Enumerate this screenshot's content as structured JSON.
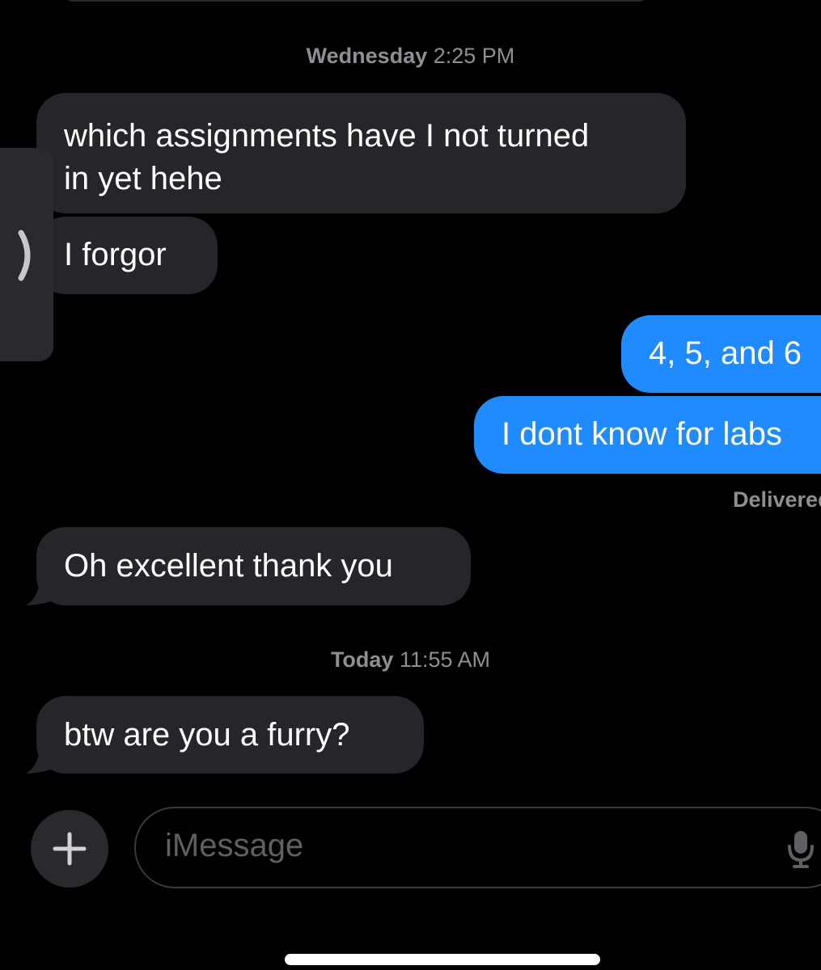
{
  "thread": {
    "timestamps": [
      {
        "day": "Wednesday",
        "time": "2:25 PM"
      },
      {
        "day": "Today",
        "time": "11:55 AM"
      }
    ],
    "messages": [
      {
        "direction": "incoming",
        "lines": [
          "which assignments have I not turned",
          "in yet hehe"
        ]
      },
      {
        "direction": "incoming",
        "lines": [
          "I forgor"
        ]
      },
      {
        "direction": "outgoing",
        "lines": [
          "4, 5, and 6"
        ]
      },
      {
        "direction": "outgoing",
        "lines": [
          "I dont know for labs"
        ]
      },
      {
        "direction": "incoming",
        "lines": [
          "Oh excellent thank you"
        ]
      },
      {
        "direction": "incoming",
        "lines": [
          "btw are you a furry?"
        ]
      }
    ],
    "delivered_label": "Delivered"
  },
  "composer": {
    "placeholder": "iMessage",
    "add_icon": "plus-icon",
    "mic_icon": "microphone-icon"
  },
  "sidebar_tab": {
    "icon": "chevron-right-icon"
  },
  "colors": {
    "background": "#000000",
    "incoming_bubble": "#26252a",
    "outgoing_bubble": "#1f8bfe",
    "meta_text": "#8e8e93"
  }
}
